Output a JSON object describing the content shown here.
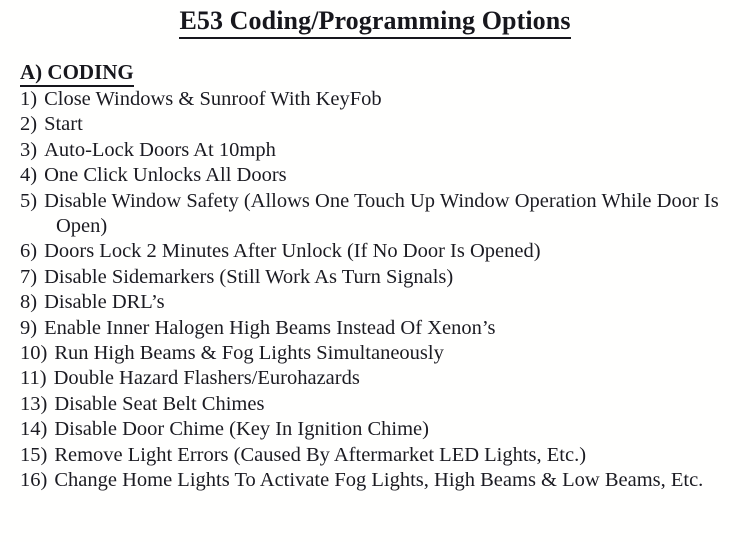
{
  "document": {
    "title": "E53 Coding/Programming Options",
    "section_heading": "A) CODING",
    "options": [
      {
        "number": "1)",
        "text": "Close Windows & Sunroof With KeyFob"
      },
      {
        "number": "2)",
        "text": "Start"
      },
      {
        "number": "3)",
        "text": "Auto-Lock Doors At 10mph"
      },
      {
        "number": "4)",
        "text": "One Click Unlocks All Doors"
      },
      {
        "number": "5)",
        "text": "Disable Window Safety (Allows One Touch Up Window Operation While Door Is Open)"
      },
      {
        "number": "6)",
        "text": "Doors Lock 2 Minutes After Unlock (If No Door Is Opened)"
      },
      {
        "number": "7)",
        "text": "Disable Sidemarkers (Still Work As Turn Signals)"
      },
      {
        "number": "8)",
        "text": "Disable DRL’s"
      },
      {
        "number": "9)",
        "text": "Enable Inner Halogen High Beams Instead Of Xenon’s"
      },
      {
        "number": "10)",
        "text": "Run High Beams & Fog Lights Simultaneously"
      },
      {
        "number": "11)",
        "text": "Double Hazard Flashers/Eurohazards"
      },
      {
        "number": "13)",
        "text": "Disable Seat Belt Chimes"
      },
      {
        "number": "14)",
        "text": "Disable Door Chime (Key In Ignition Chime)"
      },
      {
        "number": "15)",
        "text": "Remove Light Errors (Caused By Aftermarket LED Lights, Etc.)"
      },
      {
        "number": "16)",
        "text": "Change Home Lights To Activate Fog Lights, High Beams & Low Beams, Etc."
      }
    ],
    "colors": {
      "text": "#1b1b22",
      "heading": "#17171d",
      "background": "#ffffff"
    }
  }
}
